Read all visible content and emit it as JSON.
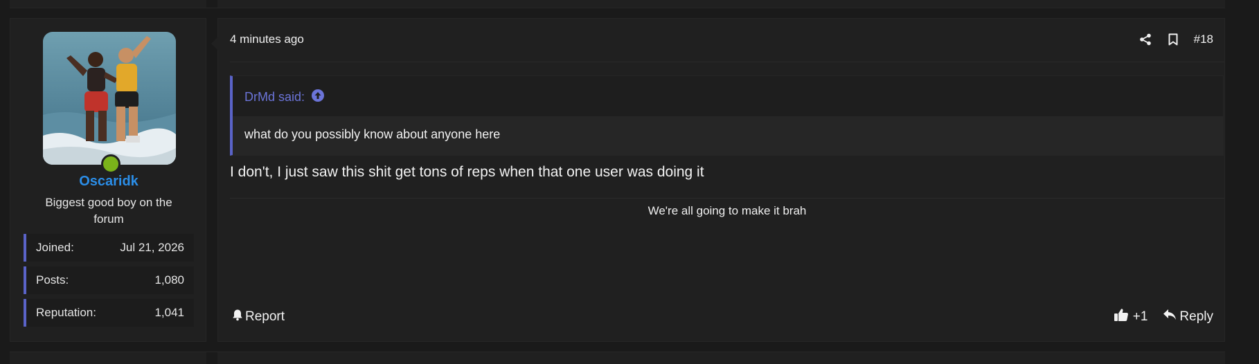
{
  "post": {
    "number": "#18",
    "date": "4 minutes ago",
    "user": {
      "name": "Oscaridk",
      "title": "Biggest good boy on the forum",
      "stats": [
        {
          "label": "Joined:",
          "value": "Jul 21, 2026"
        },
        {
          "label": "Posts:",
          "value": "1,080"
        },
        {
          "label": "Reputation:",
          "value": "1,041"
        }
      ],
      "online": true
    },
    "quote": {
      "author": "DrMd said:",
      "text": "what do you possibly know about anyone here"
    },
    "message": "I don't, I just saw this shit get tons of reps when that one user was doing it",
    "signature": "We're all going to make it brah",
    "actions": {
      "report": "Report",
      "like_count": "+1",
      "reply": "Reply"
    }
  },
  "colors": {
    "background": "#1a1a1a",
    "panel": "#202020",
    "accent": "#5a63c8",
    "username": "#2b8ee8",
    "online": "#7bb31a"
  },
  "icons": [
    "share-icon",
    "bookmark-icon",
    "arrow-up-circle-icon",
    "bell-icon",
    "thumbs-up-icon",
    "reply-icon"
  ]
}
